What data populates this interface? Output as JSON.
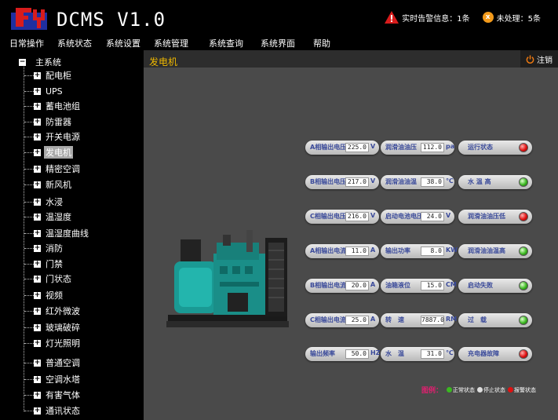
{
  "header": {
    "app_title": "DCMS V1.0",
    "realtime_alarm_label": "实时告警信息：1条",
    "unhandled_label": "未处理：5条",
    "unhandled_icon_text": "x"
  },
  "menu": [
    "日常操作",
    "系统状态",
    "系统设置",
    "系统管理",
    "系统查询",
    "系统界面",
    "帮助"
  ],
  "sidebar": {
    "root_label": "主系统",
    "items": [
      "配电柜",
      "UPS",
      "蓄电池组",
      "防雷器",
      "开关电源",
      "发电机",
      "精密空调",
      "新风机",
      "水浸",
      "温湿度",
      "温湿度曲线",
      "消防",
      "门禁",
      "门状态",
      "视频",
      "红外微波",
      "玻璃破碎",
      "灯光照明",
      "普通空调",
      "空调水塔",
      "有害气体",
      "通讯状态"
    ],
    "selected_index": 5
  },
  "main": {
    "section_title": "发电机",
    "logout_label": "注销"
  },
  "readings_col1": [
    {
      "label": "A相输出电压",
      "value": "225.0",
      "unit": "V"
    },
    {
      "label": "B相输出电压",
      "value": "217.0",
      "unit": "V"
    },
    {
      "label": "C相输出电压",
      "value": "216.0",
      "unit": "V"
    },
    {
      "label": "A相输出电流",
      "value": "11.0",
      "unit": "A"
    },
    {
      "label": "B相输出电流",
      "value": "20.0",
      "unit": "A"
    },
    {
      "label": "C相输出电流",
      "value": "25.0",
      "unit": "A"
    },
    {
      "label": "输出频率",
      "value": "50.0",
      "unit": "HZ"
    }
  ],
  "readings_col2": [
    {
      "label": "润滑油油压",
      "value": "112.0",
      "unit": "pa"
    },
    {
      "label": "润滑油油温",
      "value": "38.0",
      "unit": "℃"
    },
    {
      "label": "启动电池电压",
      "value": "24.0",
      "unit": "V"
    },
    {
      "label": "输出功率",
      "value": "8.0",
      "unit": "KW"
    },
    {
      "label": "油箱液位",
      "value": "15.0",
      "unit": "CM"
    },
    {
      "label": "转　速",
      "value": "7887.0",
      "unit": "RM"
    },
    {
      "label": "水　温",
      "value": "31.0",
      "unit": "℃"
    }
  ],
  "statuses": [
    {
      "label": "运行状态",
      "state": "red"
    },
    {
      "label": "水 温 高",
      "state": "green"
    },
    {
      "label": "润滑油油压低",
      "state": "red"
    },
    {
      "label": "润滑油油温高",
      "state": "green"
    },
    {
      "label": "启动失败",
      "state": "green"
    },
    {
      "label": "过　载",
      "state": "green"
    },
    {
      "label": "充电器故障",
      "state": "red"
    }
  ],
  "legend": {
    "title": "图例：",
    "normal": "正常状态",
    "stopped": "停止状态",
    "alarm": "报警状态"
  },
  "colors": {
    "accent_title": "#f0b800",
    "led_normal": "#3ab820",
    "led_stopped": "#dddddd",
    "led_alarm": "#e01010"
  }
}
